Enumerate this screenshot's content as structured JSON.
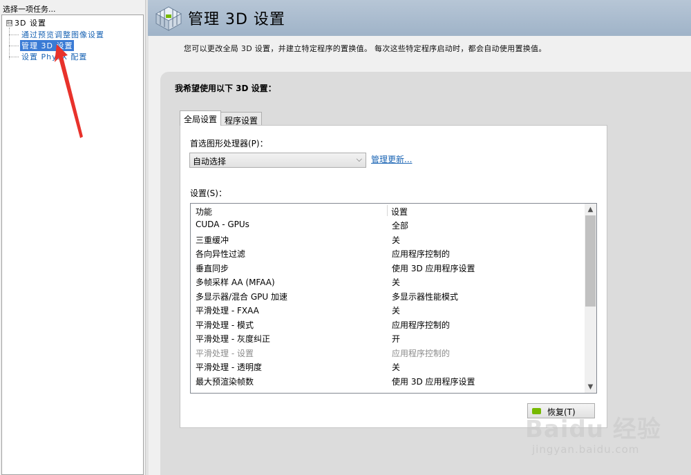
{
  "left_pane": {
    "title": "选择一项任务...",
    "tree": {
      "root_toggle": "⊟",
      "root_label": "3D 设置",
      "children": [
        {
          "label": "通过预览调整图像设置"
        },
        {
          "label": "管理 3D 设置",
          "selected": true
        },
        {
          "label": "设置 PhysX 配置"
        }
      ]
    }
  },
  "header": {
    "title": "管理 3D 设置",
    "description": "您可以更改全局 3D 设置，并建立特定程序的置换值。 每次这些特定程序启动时，都会自动使用置换值。"
  },
  "main": {
    "section_heading": "我希望使用以下 3D 设置：",
    "tabs": [
      {
        "label": "全局设置",
        "active": true
      },
      {
        "label": "程序设置",
        "active": false
      }
    ],
    "preferred_gpu": {
      "label": "首选图形处理器(P)：",
      "value": "自动选择",
      "manage_link": "管理更新..."
    },
    "settings_label": "设置(S)：",
    "table": {
      "columns": [
        "功能",
        "设置"
      ],
      "rows": [
        {
          "feature": "CUDA - GPUs",
          "setting": "全部",
          "disabled": false
        },
        {
          "feature": "三重缓冲",
          "setting": "关",
          "disabled": false
        },
        {
          "feature": "各向异性过滤",
          "setting": "应用程序控制的",
          "disabled": false
        },
        {
          "feature": "垂直同步",
          "setting": "使用 3D 应用程序设置",
          "disabled": false
        },
        {
          "feature": "多帧采样 AA (MFAA)",
          "setting": "关",
          "disabled": false
        },
        {
          "feature": "多显示器/混合 GPU 加速",
          "setting": "多显示器性能模式",
          "disabled": false
        },
        {
          "feature": "平滑处理 - FXAA",
          "setting": "关",
          "disabled": false
        },
        {
          "feature": "平滑处理 - 模式",
          "setting": "应用程序控制的",
          "disabled": false
        },
        {
          "feature": "平滑处理 - 灰度纠正",
          "setting": "开",
          "disabled": false
        },
        {
          "feature": "平滑处理 - 设置",
          "setting": "应用程序控制的",
          "disabled": true
        },
        {
          "feature": "平滑处理 - 透明度",
          "setting": "关",
          "disabled": false
        },
        {
          "feature": "最大预渲染帧数",
          "setting": "使用 3D 应用程序设置",
          "disabled": false
        }
      ],
      "scroll_position_fraction": 0.0,
      "visible_fraction": 0.55
    },
    "restore_button": "恢复(T)"
  },
  "watermark": {
    "text": "Baidu 经验",
    "sub": "jingyan.baidu.com"
  },
  "colors": {
    "header_bg": "#a9bbce",
    "link": "#1a64b4",
    "selection": "#3a7bd5",
    "nvidia_green": "#76b900",
    "annotation_red": "#e8322b"
  }
}
